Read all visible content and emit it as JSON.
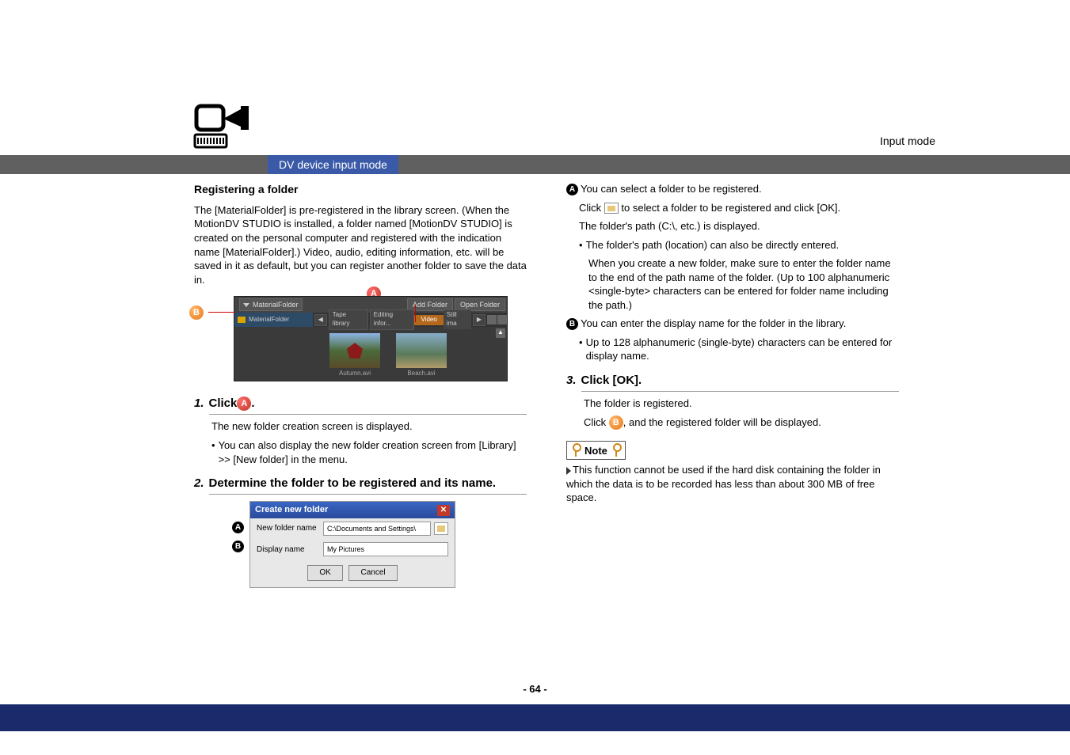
{
  "input_mode_label": "Input mode",
  "section_title": "DV device input mode",
  "left": {
    "heading": "Registering a folder",
    "intro1": "The [MaterialFolder] is pre-registered in the library screen. (When the MotionDV STUDIO is installed, a folder named [MotionDV STUDIO] is created on the personal computer and registered with the indication name [MaterialFolder].) Video, audio, editing information, etc. will be saved in it as default, but you can register another folder to save the data in.",
    "library": {
      "dropdown_label": "MaterialFolder",
      "left_panel_label": "MaterialFolder",
      "add_folder": "Add Folder",
      "open_folder": "Open Folder",
      "arrow": "◀",
      "tab1": "Tape library",
      "tab2": "Editing infor...",
      "tab_video": "Video",
      "tab_still": "Still ima",
      "play": "▶",
      "thumb1_cap": "Autumn.avi",
      "thumb2_cap": "Beach.avi"
    },
    "step1_label": "Click ",
    "step1_suffix": ".",
    "step1_text": "The new folder creation screen is displayed.",
    "step1_bullet": "You can also display the new folder creation screen from [Library] >> [New folder] in the menu.",
    "step2_label": "Determine the folder to be registered and its name.",
    "dialog": {
      "title": "Create new folder",
      "row1_lbl": "New folder name",
      "row1_val": "C:\\Documents and Settings\\",
      "row2_lbl": "Display name",
      "row2_val": "My Pictures",
      "ok": "OK",
      "cancel": "Cancel"
    }
  },
  "right": {
    "a_text": "You can select a folder to be registered.",
    "a_click1": "Click ",
    "a_click2": " to select a folder to be registered and click [OK].",
    "a_path": "The folder's path (C:\\, etc.) is displayed.",
    "a_bullet1": "The folder's path (location) can also be directly entered.",
    "a_bullet1b": "When you create a new folder, make sure to enter the folder name to the end of the path name of the folder. (Up to 100 alphanumeric <single-byte> characters can be entered for folder name including the path.)",
    "b_text": "You can enter the display name for the folder in the library.",
    "b_bullet": "Up to 128 alphanumeric (single-byte) characters can be entered for display name.",
    "step3_label": "Click [OK].",
    "step3_text": "The folder is registered.",
    "step3_click1": "Click ",
    "step3_click2": ", and the registered folder will be displayed.",
    "note_label": "Note",
    "note_text": "This function cannot be used if the hard disk containing the folder in which the data is to be recorded has less than about 300 MB of free space."
  },
  "badges": {
    "A": "A",
    "B": "B"
  },
  "page_num": "- 64 -",
  "steps": {
    "s1": "1.",
    "s2": "2.",
    "s3": "3."
  }
}
